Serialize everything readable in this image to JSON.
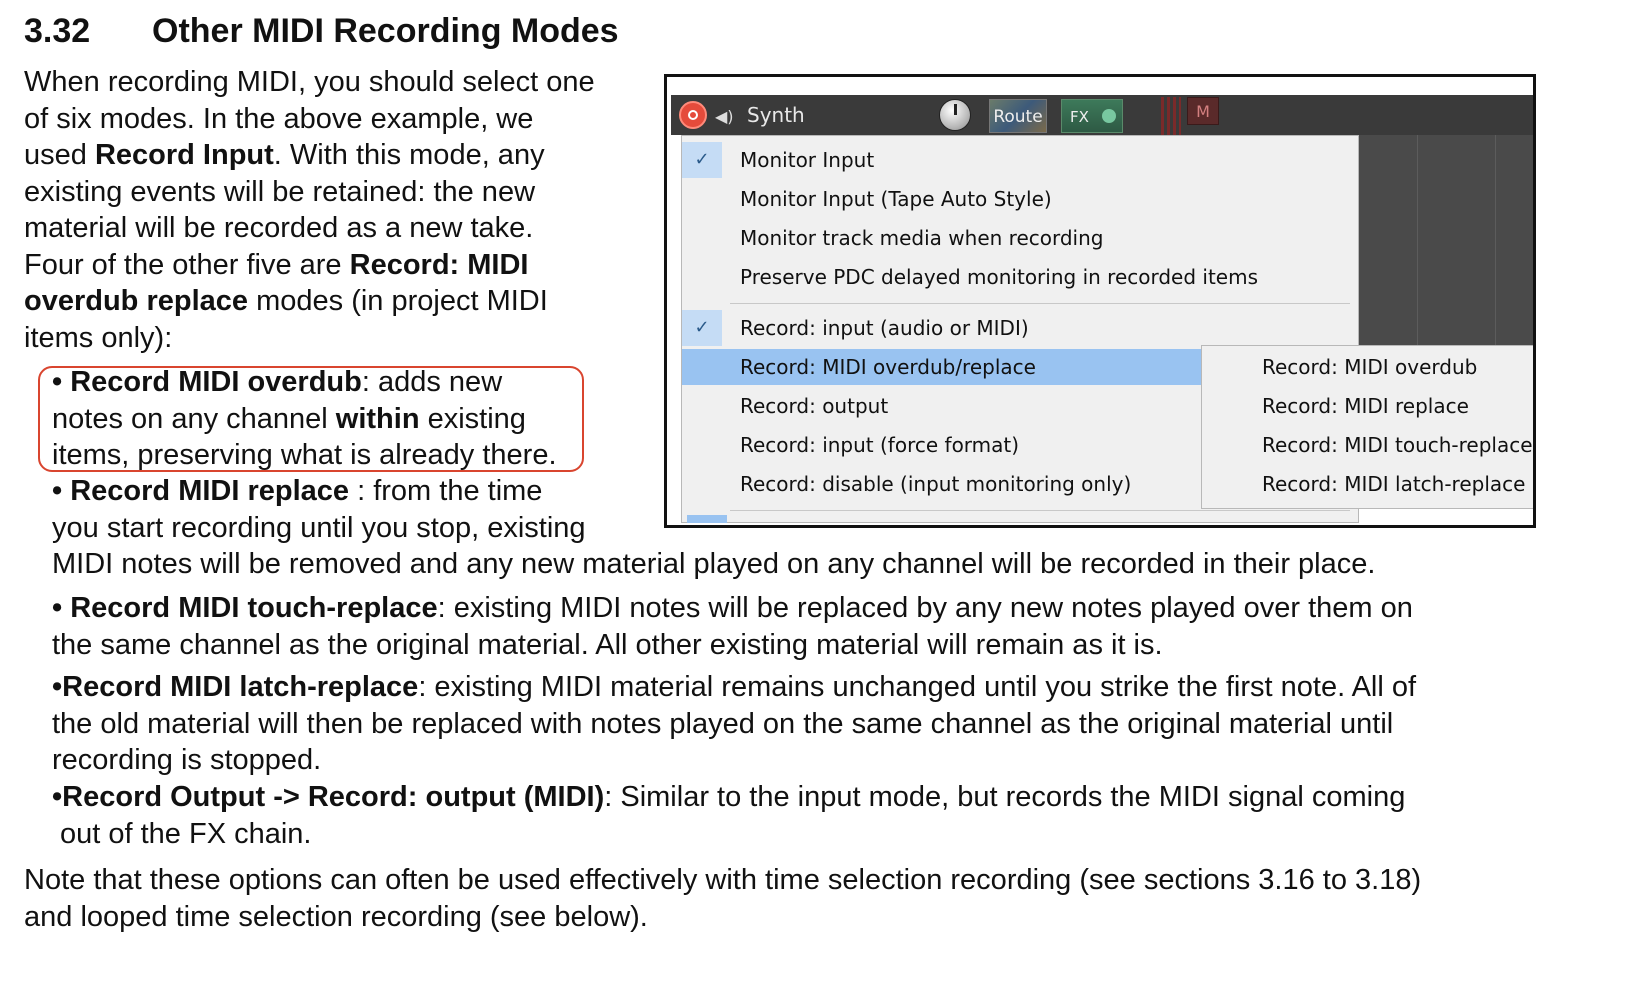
{
  "section": {
    "number": "3.32",
    "title": "Other MIDI Recording Modes"
  },
  "intro": {
    "l1": "When recording MIDI, you should select one",
    "l2": "of six modes. In the above example, we",
    "l3a": "used ",
    "l3b": "Record Input",
    "l3c": ". With this mode, any",
    "l4": "existing events  will be retained: the new",
    "l5": "material will be recorded as a new take.",
    "l6a": "Four of the other five are ",
    "l6b": "Record: MIDI",
    "l7a": "overdub replace",
    "l7b": " modes (in project MIDI",
    "l8": "items only):"
  },
  "bullets": {
    "dot": "•",
    "overdub": {
      "b": "Record MIDI overdub",
      "t1": ": adds new",
      "l2a": "notes on any channel ",
      "l2b": "within",
      "l2c": " existing",
      "l3": "items, preserving what is already there."
    },
    "replace": {
      "b": "Record MIDI replace",
      "t1": " : from the time",
      "l2": "you start recording until you stop, existing",
      "l3": "MIDI notes will be removed and any new material played on any channel will be recorded in their place."
    },
    "touch": {
      "b": "Record MIDI touch-replace",
      "t1": ": existing MIDI notes will be replaced  by any new notes played over them on",
      "l2": "the same channel as the original material. All other existing material will remain as it is."
    },
    "latch": {
      "b": "Record MIDI latch-replace",
      "t1": ": existing MIDI material remains unchanged until you strike the first note. All of",
      "l2": "the old material will then be replaced with notes played on the same channel as the original material until",
      "l3": "recording is stopped."
    },
    "output": {
      "b": "Record Output -> Record: output (MIDI)",
      "t1": ": Similar to the input mode, but records the MIDI signal coming",
      "l2": "out of the FX chain."
    }
  },
  "note": {
    "l1": "Note that these options can often be used effectively with time selection recording (see sections 3.16 to 3.18)",
    "l2": "and looped time selection recording (see below)."
  },
  "screenshot": {
    "track_name": "Synth",
    "route_label": "Route",
    "fx_label": "FX",
    "mute_label": "M",
    "check_glyph": "✓",
    "menu": [
      "Monitor Input",
      "Monitor Input (Tape Auto Style)",
      "Monitor track media when recording",
      "Preserve PDC delayed monitoring in recorded items",
      "Record: input (audio or MIDI)",
      "Record: MIDI overdub/replace",
      "Record: output",
      "Record: input (force format)",
      "Record: disable (input monitoring only)"
    ],
    "submenu": [
      "Record: MIDI overdub",
      "Record: MIDI replace",
      "Record: MIDI touch-replace",
      "Record: MIDI latch-replace"
    ]
  }
}
